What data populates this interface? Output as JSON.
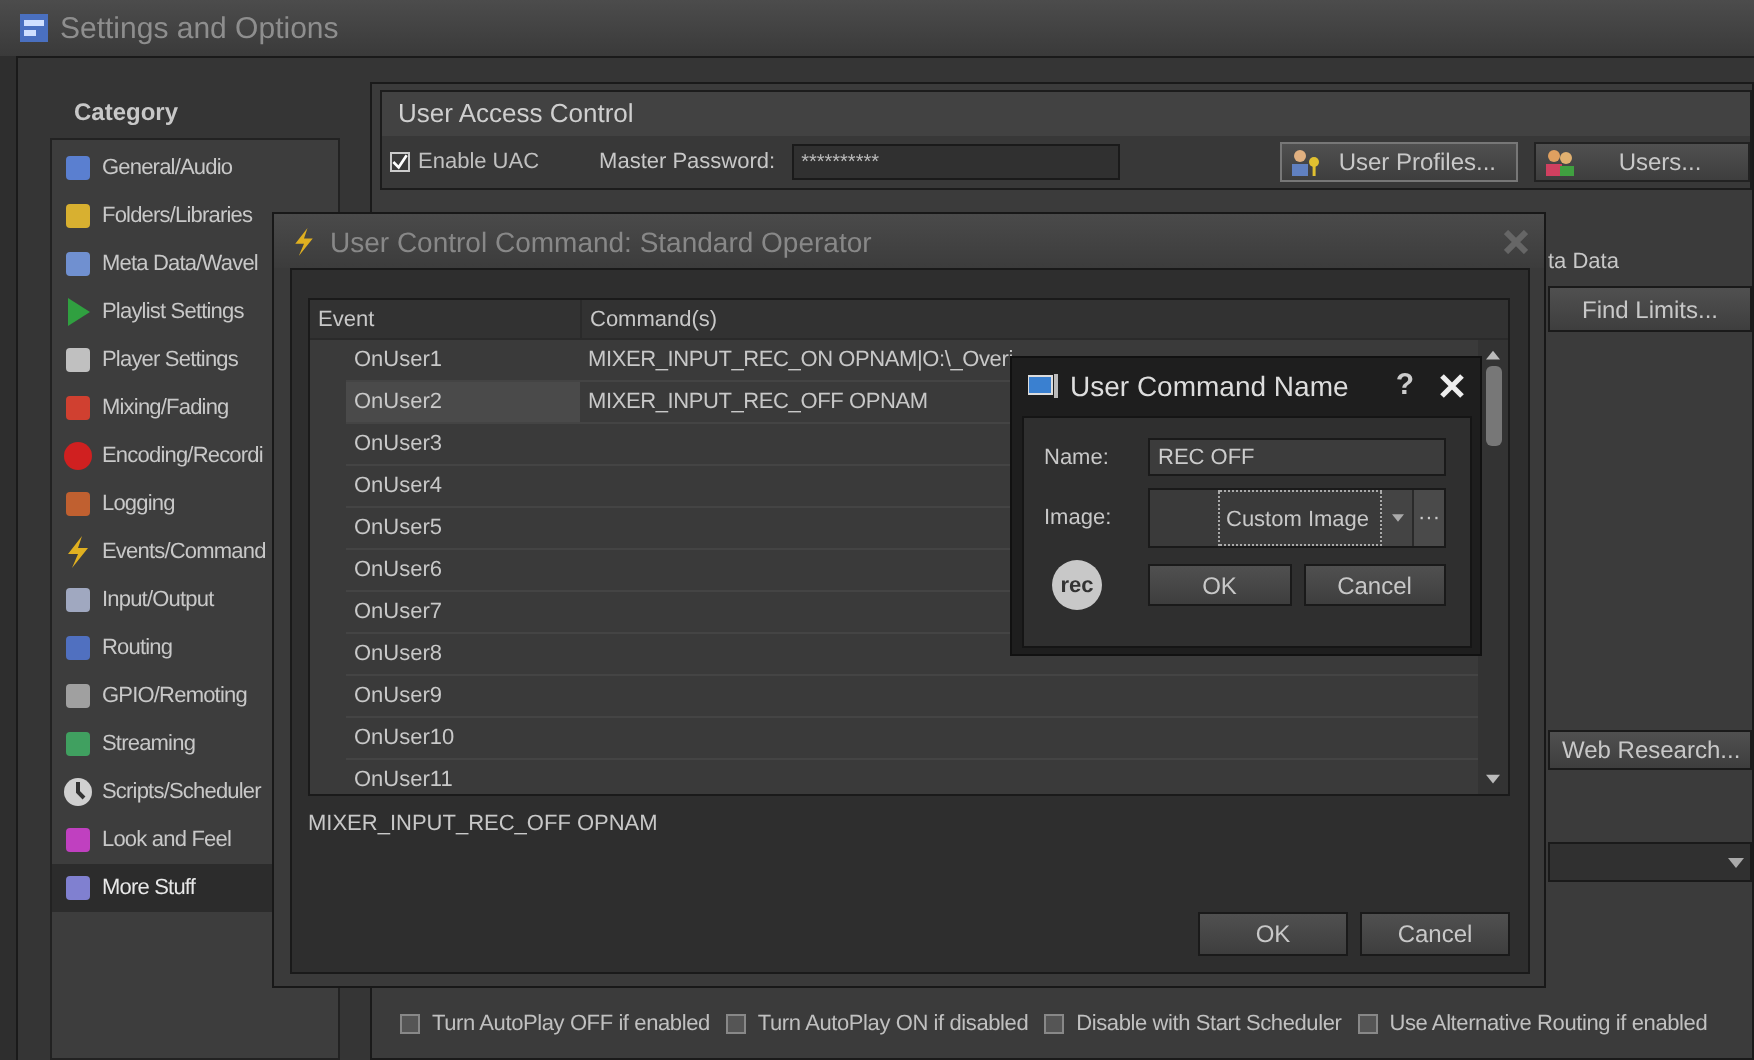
{
  "window": {
    "title": "Settings and Options"
  },
  "sidebar": {
    "title": "Category",
    "items": [
      {
        "label": "General/Audio",
        "selected": false
      },
      {
        "label": "Folders/Libraries",
        "selected": false
      },
      {
        "label": "Meta Data/Wavel",
        "selected": false
      },
      {
        "label": "Playlist Settings",
        "selected": false
      },
      {
        "label": "Player Settings",
        "selected": false
      },
      {
        "label": "Mixing/Fading",
        "selected": false
      },
      {
        "label": "Encoding/Recordi",
        "selected": false
      },
      {
        "label": "Logging",
        "selected": false
      },
      {
        "label": "Events/Command",
        "selected": false
      },
      {
        "label": "Input/Output",
        "selected": false
      },
      {
        "label": "Routing",
        "selected": false
      },
      {
        "label": "GPIO/Remoting",
        "selected": false
      },
      {
        "label": "Streaming",
        "selected": false
      },
      {
        "label": "Scripts/Scheduler",
        "selected": false
      },
      {
        "label": "Look and Feel",
        "selected": false
      },
      {
        "label": "More Stuff",
        "selected": true
      }
    ]
  },
  "uac": {
    "title": "User Access Control",
    "enable": {
      "label": "Enable UAC",
      "checked": true
    },
    "password_label": "Master Password:",
    "password_value": "**********",
    "buttons": [
      "User Profiles...",
      "Users..."
    ]
  },
  "side_strip": {
    "label": "ta Data",
    "buttons": [
      "Find Limits...",
      "Web Research..."
    ]
  },
  "live_assist": {
    "options": [
      {
        "label": "Turn AutoPlay OFF if enabled",
        "checked": false
      },
      {
        "label": "Turn AutoPlay ON if disabled",
        "checked": false
      },
      {
        "label": "Disable with Start Scheduler",
        "checked": false
      },
      {
        "label": "Use Alternative Routing if enabled",
        "checked": false
      }
    ]
  },
  "command_dialog": {
    "title": "User Control Command: Standard Operator",
    "columns": [
      "Event",
      "Command(s)"
    ],
    "rows": [
      {
        "event": "OnUser1",
        "command": "MIXER_INPUT_REC_ON OPNAM|O:\\_Overi",
        "selected": false
      },
      {
        "event": "OnUser2",
        "command": "MIXER_INPUT_REC_OFF OPNAM",
        "selected": true
      },
      {
        "event": "OnUser3",
        "command": "",
        "selected": false
      },
      {
        "event": "OnUser4",
        "command": "",
        "selected": false
      },
      {
        "event": "OnUser5",
        "command": "",
        "selected": false
      },
      {
        "event": "OnUser6",
        "command": "",
        "selected": false
      },
      {
        "event": "OnUser7",
        "command": "",
        "selected": false
      },
      {
        "event": "OnUser8",
        "command": "",
        "selected": false
      },
      {
        "event": "OnUser9",
        "command": "",
        "selected": false
      },
      {
        "event": "OnUser10",
        "command": "",
        "selected": false
      },
      {
        "event": "OnUser11",
        "command": "",
        "selected": false
      }
    ],
    "preview": "MIXER_INPUT_REC_OFF OPNAM",
    "buttons": [
      "OK",
      "Cancel"
    ]
  },
  "name_dialog": {
    "title": "User Command Name",
    "help": "?",
    "name_label": "Name:",
    "name_value": "REC OFF",
    "image_label": "Image:",
    "image_value": "Custom Image",
    "browse": "···",
    "badge": "rec",
    "buttons": [
      "OK",
      "Cancel"
    ]
  }
}
